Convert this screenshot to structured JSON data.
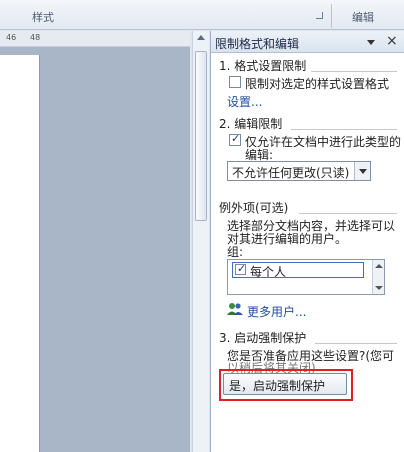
{
  "ribbon": {
    "styles_label": "样式",
    "edit_label": "编辑"
  },
  "ruler": {
    "tick_46": "46",
    "tick_48": "48"
  },
  "pane": {
    "title": "限制格式和编辑",
    "close_glyph": "×",
    "section1": {
      "title": "1. 格式设置限制",
      "checkbox_label": "限制对选定的样式设置格式",
      "checked": false,
      "settings_link": "设置..."
    },
    "section2": {
      "title": "2. 编辑限制",
      "checkbox_label_line1": "仅允许在文档中进行此类型的",
      "checkbox_label_line2": "编辑:",
      "checked": true,
      "select_value": "不允许任何更改(只读)"
    },
    "exceptions": {
      "title": "例外项(可选)",
      "desc_line1": "选择部分文档内容，并选择可以",
      "desc_line2": "对其进行编辑的用户。",
      "group_label": "组:",
      "group_item": "每个人",
      "group_item_checked": true,
      "more_users_link": "更多用户..."
    },
    "section3": {
      "title": "3. 启动强制保护",
      "question_line1": "您是否准备应用这些设置?(您可",
      "question_line2": "以稍后将其关闭)",
      "button_label": "是，启动强制保护"
    }
  },
  "colors": {
    "highlight": "#e02020",
    "link": "#1f4ea8"
  }
}
